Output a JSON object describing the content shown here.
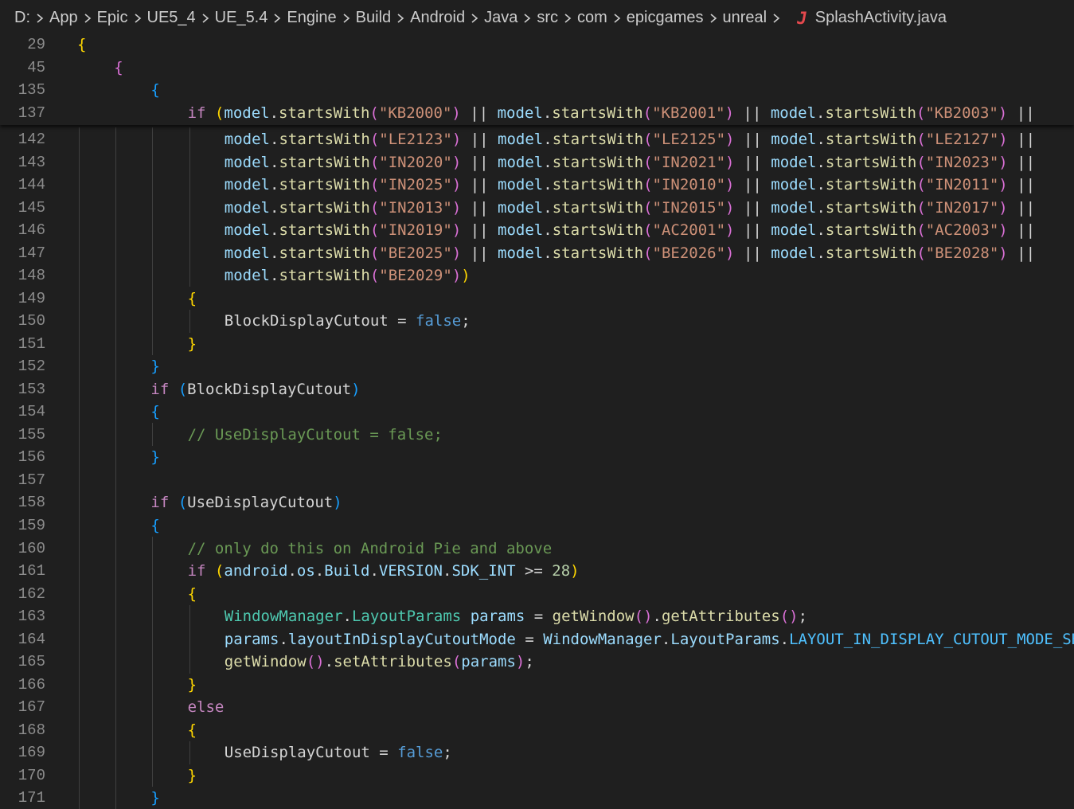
{
  "breadcrumb": {
    "items": [
      "D:",
      "App",
      "Epic",
      "UE5_4",
      "UE_5.4",
      "Engine",
      "Build",
      "Android",
      "Java",
      "src",
      "com",
      "epicgames",
      "unreal"
    ],
    "file_icon": "J",
    "file_name": "SplashActivity.java"
  },
  "colors": {
    "background": "#1f1f1f",
    "line_number": "#8c8c8c",
    "keyword": "#c586c0",
    "variable": "#9cdcfe",
    "function": "#dcdcaa",
    "string": "#ce9178",
    "boolean": "#569cd6",
    "comment": "#6a9955",
    "class": "#4ec9b0",
    "constant": "#4fc1ff",
    "number": "#b5cea8",
    "bracket_level_1": "#ffd700",
    "bracket_level_2": "#da70d6",
    "bracket_level_3": "#179fff",
    "java_icon": "#e5484d"
  },
  "sticky_lines": [
    {
      "num": "29",
      "indent": 0,
      "tokens": [
        {
          "t": "{",
          "c": "b1"
        }
      ]
    },
    {
      "num": "45",
      "indent": 1,
      "tokens": [
        {
          "t": "{",
          "c": "b2"
        }
      ]
    },
    {
      "num": "135",
      "indent": 2,
      "tokens": [
        {
          "t": "{",
          "c": "b3"
        }
      ]
    },
    {
      "num": "137",
      "indent": 3,
      "tokens": [
        {
          "t": "if ",
          "c": "kw"
        },
        {
          "t": "(",
          "c": "b1"
        },
        {
          "t": "model",
          "c": "var"
        },
        {
          "t": ".",
          "c": "plain"
        },
        {
          "t": "startsWith",
          "c": "fn"
        },
        {
          "t": "(",
          "c": "b2"
        },
        {
          "t": "\"KB2000\"",
          "c": "str"
        },
        {
          "t": ")",
          "c": "b2"
        },
        {
          "t": " || ",
          "c": "op"
        },
        {
          "t": "model",
          "c": "var"
        },
        {
          "t": ".",
          "c": "plain"
        },
        {
          "t": "startsWith",
          "c": "fn"
        },
        {
          "t": "(",
          "c": "b2"
        },
        {
          "t": "\"KB2001\"",
          "c": "str"
        },
        {
          "t": ")",
          "c": "b2"
        },
        {
          "t": " || ",
          "c": "op"
        },
        {
          "t": "model",
          "c": "var"
        },
        {
          "t": ".",
          "c": "plain"
        },
        {
          "t": "startsWith",
          "c": "fn"
        },
        {
          "t": "(",
          "c": "b2"
        },
        {
          "t": "\"KB2003\"",
          "c": "str"
        },
        {
          "t": ")",
          "c": "b2"
        },
        {
          "t": " ||",
          "c": "op"
        }
      ]
    }
  ],
  "lines": [
    {
      "num": "142",
      "indent": 4,
      "tokens": [
        {
          "t": "model",
          "c": "var"
        },
        {
          "t": ".",
          "c": "plain"
        },
        {
          "t": "startsWith",
          "c": "fn"
        },
        {
          "t": "(",
          "c": "b2"
        },
        {
          "t": "\"LE2123\"",
          "c": "str"
        },
        {
          "t": ")",
          "c": "b2"
        },
        {
          "t": " || ",
          "c": "op"
        },
        {
          "t": "model",
          "c": "var"
        },
        {
          "t": ".",
          "c": "plain"
        },
        {
          "t": "startsWith",
          "c": "fn"
        },
        {
          "t": "(",
          "c": "b2"
        },
        {
          "t": "\"LE2125\"",
          "c": "str"
        },
        {
          "t": ")",
          "c": "b2"
        },
        {
          "t": " || ",
          "c": "op"
        },
        {
          "t": "model",
          "c": "var"
        },
        {
          "t": ".",
          "c": "plain"
        },
        {
          "t": "startsWith",
          "c": "fn"
        },
        {
          "t": "(",
          "c": "b2"
        },
        {
          "t": "\"LE2127\"",
          "c": "str"
        },
        {
          "t": ")",
          "c": "b2"
        },
        {
          "t": " ||",
          "c": "op"
        }
      ]
    },
    {
      "num": "143",
      "indent": 4,
      "tokens": [
        {
          "t": "model",
          "c": "var"
        },
        {
          "t": ".",
          "c": "plain"
        },
        {
          "t": "startsWith",
          "c": "fn"
        },
        {
          "t": "(",
          "c": "b2"
        },
        {
          "t": "\"IN2020\"",
          "c": "str"
        },
        {
          "t": ")",
          "c": "b2"
        },
        {
          "t": " || ",
          "c": "op"
        },
        {
          "t": "model",
          "c": "var"
        },
        {
          "t": ".",
          "c": "plain"
        },
        {
          "t": "startsWith",
          "c": "fn"
        },
        {
          "t": "(",
          "c": "b2"
        },
        {
          "t": "\"IN2021\"",
          "c": "str"
        },
        {
          "t": ")",
          "c": "b2"
        },
        {
          "t": " || ",
          "c": "op"
        },
        {
          "t": "model",
          "c": "var"
        },
        {
          "t": ".",
          "c": "plain"
        },
        {
          "t": "startsWith",
          "c": "fn"
        },
        {
          "t": "(",
          "c": "b2"
        },
        {
          "t": "\"IN2023\"",
          "c": "str"
        },
        {
          "t": ")",
          "c": "b2"
        },
        {
          "t": " ||",
          "c": "op"
        }
      ]
    },
    {
      "num": "144",
      "indent": 4,
      "tokens": [
        {
          "t": "model",
          "c": "var"
        },
        {
          "t": ".",
          "c": "plain"
        },
        {
          "t": "startsWith",
          "c": "fn"
        },
        {
          "t": "(",
          "c": "b2"
        },
        {
          "t": "\"IN2025\"",
          "c": "str"
        },
        {
          "t": ")",
          "c": "b2"
        },
        {
          "t": " || ",
          "c": "op"
        },
        {
          "t": "model",
          "c": "var"
        },
        {
          "t": ".",
          "c": "plain"
        },
        {
          "t": "startsWith",
          "c": "fn"
        },
        {
          "t": "(",
          "c": "b2"
        },
        {
          "t": "\"IN2010\"",
          "c": "str"
        },
        {
          "t": ")",
          "c": "b2"
        },
        {
          "t": " || ",
          "c": "op"
        },
        {
          "t": "model",
          "c": "var"
        },
        {
          "t": ".",
          "c": "plain"
        },
        {
          "t": "startsWith",
          "c": "fn"
        },
        {
          "t": "(",
          "c": "b2"
        },
        {
          "t": "\"IN2011\"",
          "c": "str"
        },
        {
          "t": ")",
          "c": "b2"
        },
        {
          "t": " ||",
          "c": "op"
        }
      ]
    },
    {
      "num": "145",
      "indent": 4,
      "tokens": [
        {
          "t": "model",
          "c": "var"
        },
        {
          "t": ".",
          "c": "plain"
        },
        {
          "t": "startsWith",
          "c": "fn"
        },
        {
          "t": "(",
          "c": "b2"
        },
        {
          "t": "\"IN2013\"",
          "c": "str"
        },
        {
          "t": ")",
          "c": "b2"
        },
        {
          "t": " || ",
          "c": "op"
        },
        {
          "t": "model",
          "c": "var"
        },
        {
          "t": ".",
          "c": "plain"
        },
        {
          "t": "startsWith",
          "c": "fn"
        },
        {
          "t": "(",
          "c": "b2"
        },
        {
          "t": "\"IN2015\"",
          "c": "str"
        },
        {
          "t": ")",
          "c": "b2"
        },
        {
          "t": " || ",
          "c": "op"
        },
        {
          "t": "model",
          "c": "var"
        },
        {
          "t": ".",
          "c": "plain"
        },
        {
          "t": "startsWith",
          "c": "fn"
        },
        {
          "t": "(",
          "c": "b2"
        },
        {
          "t": "\"IN2017\"",
          "c": "str"
        },
        {
          "t": ")",
          "c": "b2"
        },
        {
          "t": " ||",
          "c": "op"
        }
      ]
    },
    {
      "num": "146",
      "indent": 4,
      "tokens": [
        {
          "t": "model",
          "c": "var"
        },
        {
          "t": ".",
          "c": "plain"
        },
        {
          "t": "startsWith",
          "c": "fn"
        },
        {
          "t": "(",
          "c": "b2"
        },
        {
          "t": "\"IN2019\"",
          "c": "str"
        },
        {
          "t": ")",
          "c": "b2"
        },
        {
          "t": " || ",
          "c": "op"
        },
        {
          "t": "model",
          "c": "var"
        },
        {
          "t": ".",
          "c": "plain"
        },
        {
          "t": "startsWith",
          "c": "fn"
        },
        {
          "t": "(",
          "c": "b2"
        },
        {
          "t": "\"AC2001\"",
          "c": "str"
        },
        {
          "t": ")",
          "c": "b2"
        },
        {
          "t": " || ",
          "c": "op"
        },
        {
          "t": "model",
          "c": "var"
        },
        {
          "t": ".",
          "c": "plain"
        },
        {
          "t": "startsWith",
          "c": "fn"
        },
        {
          "t": "(",
          "c": "b2"
        },
        {
          "t": "\"AC2003\"",
          "c": "str"
        },
        {
          "t": ")",
          "c": "b2"
        },
        {
          "t": " ||",
          "c": "op"
        }
      ]
    },
    {
      "num": "147",
      "indent": 4,
      "tokens": [
        {
          "t": "model",
          "c": "var"
        },
        {
          "t": ".",
          "c": "plain"
        },
        {
          "t": "startsWith",
          "c": "fn"
        },
        {
          "t": "(",
          "c": "b2"
        },
        {
          "t": "\"BE2025\"",
          "c": "str"
        },
        {
          "t": ")",
          "c": "b2"
        },
        {
          "t": " || ",
          "c": "op"
        },
        {
          "t": "model",
          "c": "var"
        },
        {
          "t": ".",
          "c": "plain"
        },
        {
          "t": "startsWith",
          "c": "fn"
        },
        {
          "t": "(",
          "c": "b2"
        },
        {
          "t": "\"BE2026\"",
          "c": "str"
        },
        {
          "t": ")",
          "c": "b2"
        },
        {
          "t": " || ",
          "c": "op"
        },
        {
          "t": "model",
          "c": "var"
        },
        {
          "t": ".",
          "c": "plain"
        },
        {
          "t": "startsWith",
          "c": "fn"
        },
        {
          "t": "(",
          "c": "b2"
        },
        {
          "t": "\"BE2028\"",
          "c": "str"
        },
        {
          "t": ")",
          "c": "b2"
        },
        {
          "t": " ||",
          "c": "op"
        }
      ]
    },
    {
      "num": "148",
      "indent": 4,
      "tokens": [
        {
          "t": "model",
          "c": "var"
        },
        {
          "t": ".",
          "c": "plain"
        },
        {
          "t": "startsWith",
          "c": "fn"
        },
        {
          "t": "(",
          "c": "b2"
        },
        {
          "t": "\"BE2029\"",
          "c": "str"
        },
        {
          "t": ")",
          "c": "b2"
        },
        {
          "t": ")",
          "c": "b1"
        }
      ]
    },
    {
      "num": "149",
      "indent": 3,
      "tokens": [
        {
          "t": "{",
          "c": "b1"
        }
      ]
    },
    {
      "num": "150",
      "indent": 4,
      "tokens": [
        {
          "t": "BlockDisplayCutout",
          "c": "plain"
        },
        {
          "t": " = ",
          "c": "op"
        },
        {
          "t": "false",
          "c": "bool"
        },
        {
          "t": ";",
          "c": "plain"
        }
      ]
    },
    {
      "num": "151",
      "indent": 3,
      "tokens": [
        {
          "t": "}",
          "c": "b1"
        }
      ]
    },
    {
      "num": "152",
      "indent": 2,
      "tokens": [
        {
          "t": "}",
          "c": "b3"
        }
      ]
    },
    {
      "num": "153",
      "indent": 2,
      "tokens": [
        {
          "t": "if ",
          "c": "kw"
        },
        {
          "t": "(",
          "c": "b3"
        },
        {
          "t": "BlockDisplayCutout",
          "c": "plain"
        },
        {
          "t": ")",
          "c": "b3"
        }
      ]
    },
    {
      "num": "154",
      "indent": 2,
      "tokens": [
        {
          "t": "{",
          "c": "b3"
        }
      ]
    },
    {
      "num": "155",
      "indent": 3,
      "tokens": [
        {
          "t": "// UseDisplayCutout = false;",
          "c": "cm"
        }
      ]
    },
    {
      "num": "156",
      "indent": 2,
      "tokens": [
        {
          "t": "}",
          "c": "b3"
        }
      ]
    },
    {
      "num": "157",
      "indent": 0,
      "tokens": []
    },
    {
      "num": "158",
      "indent": 2,
      "tokens": [
        {
          "t": "if ",
          "c": "kw"
        },
        {
          "t": "(",
          "c": "b3"
        },
        {
          "t": "UseDisplayCutout",
          "c": "plain"
        },
        {
          "t": ")",
          "c": "b3"
        }
      ]
    },
    {
      "num": "159",
      "indent": 2,
      "tokens": [
        {
          "t": "{",
          "c": "b3"
        }
      ]
    },
    {
      "num": "160",
      "indent": 3,
      "tokens": [
        {
          "t": "// only do this on Android Pie and above",
          "c": "cm"
        }
      ]
    },
    {
      "num": "161",
      "indent": 3,
      "tokens": [
        {
          "t": "if ",
          "c": "kw"
        },
        {
          "t": "(",
          "c": "b1"
        },
        {
          "t": "android",
          "c": "var"
        },
        {
          "t": ".",
          "c": "plain"
        },
        {
          "t": "os",
          "c": "var"
        },
        {
          "t": ".",
          "c": "plain"
        },
        {
          "t": "Build",
          "c": "var"
        },
        {
          "t": ".",
          "c": "plain"
        },
        {
          "t": "VERSION",
          "c": "var"
        },
        {
          "t": ".",
          "c": "plain"
        },
        {
          "t": "SDK_INT",
          "c": "var"
        },
        {
          "t": " >= ",
          "c": "op"
        },
        {
          "t": "28",
          "c": "num"
        },
        {
          "t": ")",
          "c": "b1"
        }
      ]
    },
    {
      "num": "162",
      "indent": 3,
      "tokens": [
        {
          "t": "{",
          "c": "b1"
        }
      ]
    },
    {
      "num": "163",
      "indent": 4,
      "tokens": [
        {
          "t": "WindowManager",
          "c": "cls"
        },
        {
          "t": ".",
          "c": "plain"
        },
        {
          "t": "LayoutParams",
          "c": "cls"
        },
        {
          "t": " ",
          "c": "plain"
        },
        {
          "t": "params",
          "c": "var"
        },
        {
          "t": " = ",
          "c": "op"
        },
        {
          "t": "getWindow",
          "c": "fn"
        },
        {
          "t": "()",
          "c": "b2"
        },
        {
          "t": ".",
          "c": "plain"
        },
        {
          "t": "getAttributes",
          "c": "fn"
        },
        {
          "t": "()",
          "c": "b2"
        },
        {
          "t": ";",
          "c": "plain"
        }
      ]
    },
    {
      "num": "164",
      "indent": 4,
      "tokens": [
        {
          "t": "params",
          "c": "var"
        },
        {
          "t": ".",
          "c": "plain"
        },
        {
          "t": "layoutInDisplayCutoutMode",
          "c": "var"
        },
        {
          "t": " = ",
          "c": "op"
        },
        {
          "t": "WindowManager",
          "c": "var"
        },
        {
          "t": ".",
          "c": "plain"
        },
        {
          "t": "LayoutParams",
          "c": "var"
        },
        {
          "t": ".",
          "c": "plain"
        },
        {
          "t": "LAYOUT_IN_DISPLAY_CUTOUT_MODE_SHORT_EDGES;",
          "c": "const"
        }
      ]
    },
    {
      "num": "165",
      "indent": 4,
      "tokens": [
        {
          "t": "getWindow",
          "c": "fn"
        },
        {
          "t": "()",
          "c": "b2"
        },
        {
          "t": ".",
          "c": "plain"
        },
        {
          "t": "setAttributes",
          "c": "fn"
        },
        {
          "t": "(",
          "c": "b2"
        },
        {
          "t": "params",
          "c": "var"
        },
        {
          "t": ")",
          "c": "b2"
        },
        {
          "t": ";",
          "c": "plain"
        }
      ]
    },
    {
      "num": "166",
      "indent": 3,
      "tokens": [
        {
          "t": "}",
          "c": "b1"
        }
      ]
    },
    {
      "num": "167",
      "indent": 3,
      "tokens": [
        {
          "t": "else",
          "c": "kw"
        }
      ]
    },
    {
      "num": "168",
      "indent": 3,
      "tokens": [
        {
          "t": "{",
          "c": "b1"
        }
      ]
    },
    {
      "num": "169",
      "indent": 4,
      "tokens": [
        {
          "t": "UseDisplayCutout",
          "c": "plain"
        },
        {
          "t": " = ",
          "c": "op"
        },
        {
          "t": "false",
          "c": "bool"
        },
        {
          "t": ";",
          "c": "plain"
        }
      ]
    },
    {
      "num": "170",
      "indent": 3,
      "tokens": [
        {
          "t": "}",
          "c": "b1"
        }
      ]
    },
    {
      "num": "171",
      "indent": 2,
      "tokens": [
        {
          "t": "}",
          "c": "b3"
        }
      ]
    }
  ]
}
